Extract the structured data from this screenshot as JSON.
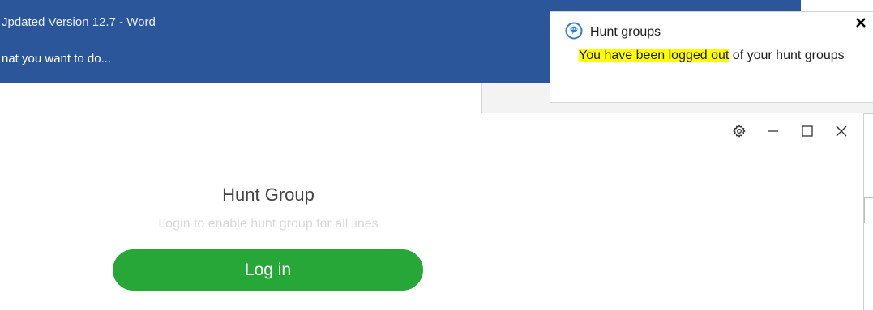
{
  "word": {
    "title": "Jpdated Version 12.7 - Word",
    "tell_me": "nat you want to do...",
    "titlebar_color": "#2b579a"
  },
  "app": {
    "title": "Hunt Group",
    "subtitle": "Login to enable hunt group for all lines",
    "login_label": "Log in",
    "accent_color": "#27a737",
    "controls": [
      "gear-icon",
      "minimize-icon",
      "maximize-icon",
      "close-icon"
    ]
  },
  "toast": {
    "title": "Hunt groups",
    "message_highlight": "You have been logged out",
    "message_rest": " of your hunt groups",
    "highlight_color": "#ffff00",
    "icon": "hunt-groups-app-icon",
    "close_icon": "close-icon"
  }
}
